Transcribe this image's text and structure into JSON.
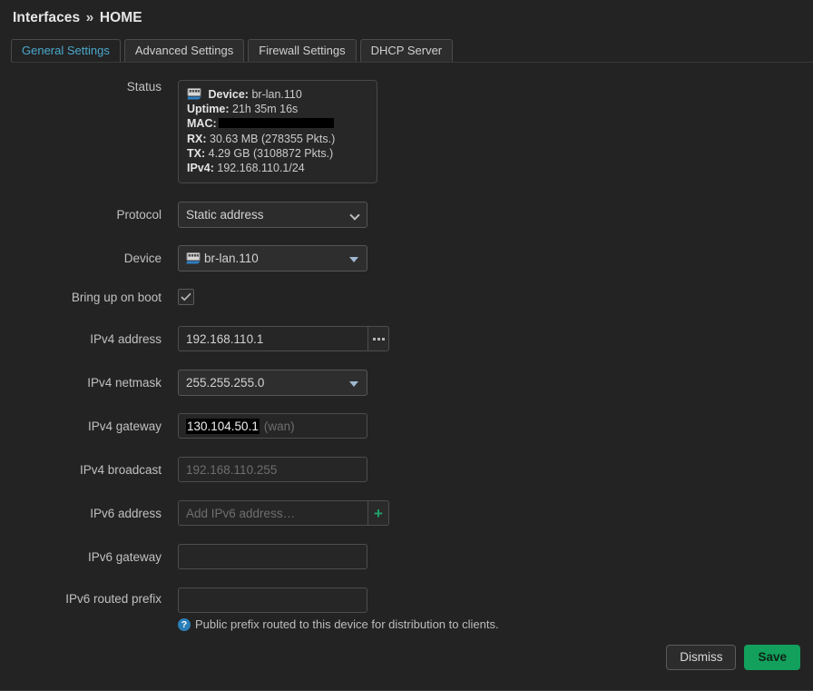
{
  "breadcrumb": {
    "section": "Interfaces",
    "separator": "»",
    "name": "HOME"
  },
  "tabs": [
    {
      "label": "General Settings",
      "active": true
    },
    {
      "label": "Advanced Settings",
      "active": false
    },
    {
      "label": "Firewall Settings",
      "active": false
    },
    {
      "label": "DHCP Server",
      "active": false
    }
  ],
  "labels": {
    "status": "Status",
    "protocol": "Protocol",
    "device": "Device",
    "bring_up_on_boot": "Bring up on boot",
    "ipv4_address": "IPv4 address",
    "ipv4_netmask": "IPv4 netmask",
    "ipv4_gateway": "IPv4 gateway",
    "ipv4_broadcast": "IPv4 broadcast",
    "ipv6_address": "IPv6 address",
    "ipv6_gateway": "IPv6 gateway",
    "ipv6_routed_prefix": "IPv6 routed prefix"
  },
  "status": {
    "device_key": "Device:",
    "device_value": "br-lan.110",
    "uptime_key": "Uptime:",
    "uptime_value": "21h 35m 16s",
    "mac_key": "MAC:",
    "mac_value": "",
    "rx_key": "RX:",
    "rx_value": "30.63 MB (278355 Pkts.)",
    "tx_key": "TX:",
    "tx_value": "4.29 GB (3108872 Pkts.)",
    "ipv4_key": "IPv4:",
    "ipv4_value": "192.168.110.1/24",
    "icon": "network-switch-icon"
  },
  "fields": {
    "protocol": {
      "value": "Static address",
      "options": [
        "Static address"
      ]
    },
    "device": {
      "value": "br-lan.110",
      "icon": "network-switch-icon"
    },
    "bring_up_on_boot": {
      "checked": true
    },
    "ipv4_address": {
      "value": "192.168.110.1",
      "placeholder": "",
      "side_button": "ellipsis-icon"
    },
    "ipv4_netmask": {
      "value": "255.255.255.0",
      "options": [
        "255.255.255.0"
      ]
    },
    "ipv4_gateway": {
      "value": "130.104.50.1",
      "hint": "(wan)",
      "selected": true
    },
    "ipv4_broadcast": {
      "value": "",
      "placeholder": "192.168.110.255"
    },
    "ipv6_address": {
      "value": "",
      "placeholder": "Add IPv6 address…",
      "side_button": "plus-icon"
    },
    "ipv6_gateway": {
      "value": "",
      "placeholder": ""
    },
    "ipv6_routed_prefix": {
      "value": "",
      "placeholder": "",
      "description": "Public prefix routed to this device for distribution to clients."
    }
  },
  "footer": {
    "dismiss": "Dismiss",
    "save": "Save"
  },
  "colors": {
    "accent_green": "#12a05c",
    "tab_active": "#4aa8cc",
    "help_blue": "#2b7fb8",
    "background": "#232323"
  }
}
